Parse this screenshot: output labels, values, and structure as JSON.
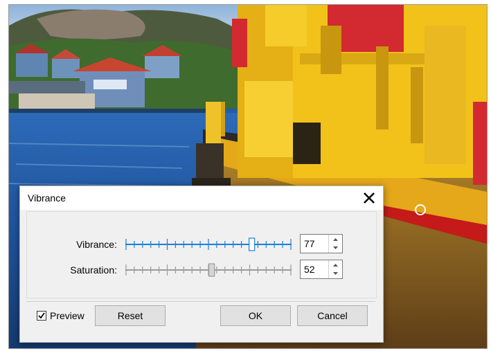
{
  "dialog": {
    "title": "Vibrance",
    "close_icon": "close-x-icon"
  },
  "controls": {
    "vibrance": {
      "label": "Vibrance:",
      "value": "77",
      "level": 77,
      "max": 100,
      "active": true
    },
    "saturation": {
      "label": "Saturation:",
      "value": "52",
      "level": 52,
      "max": 100,
      "active": false
    }
  },
  "preview": {
    "label": "Preview",
    "checked": true,
    "check_icon": "checkmark-icon"
  },
  "buttons": {
    "reset": "Reset",
    "ok": "OK",
    "cancel": "Cancel"
  },
  "colors": {
    "active_slider": "#1a7fd8",
    "inactive_slider": "#9a9a9a",
    "dialog_bg": "#f0f0f0"
  }
}
